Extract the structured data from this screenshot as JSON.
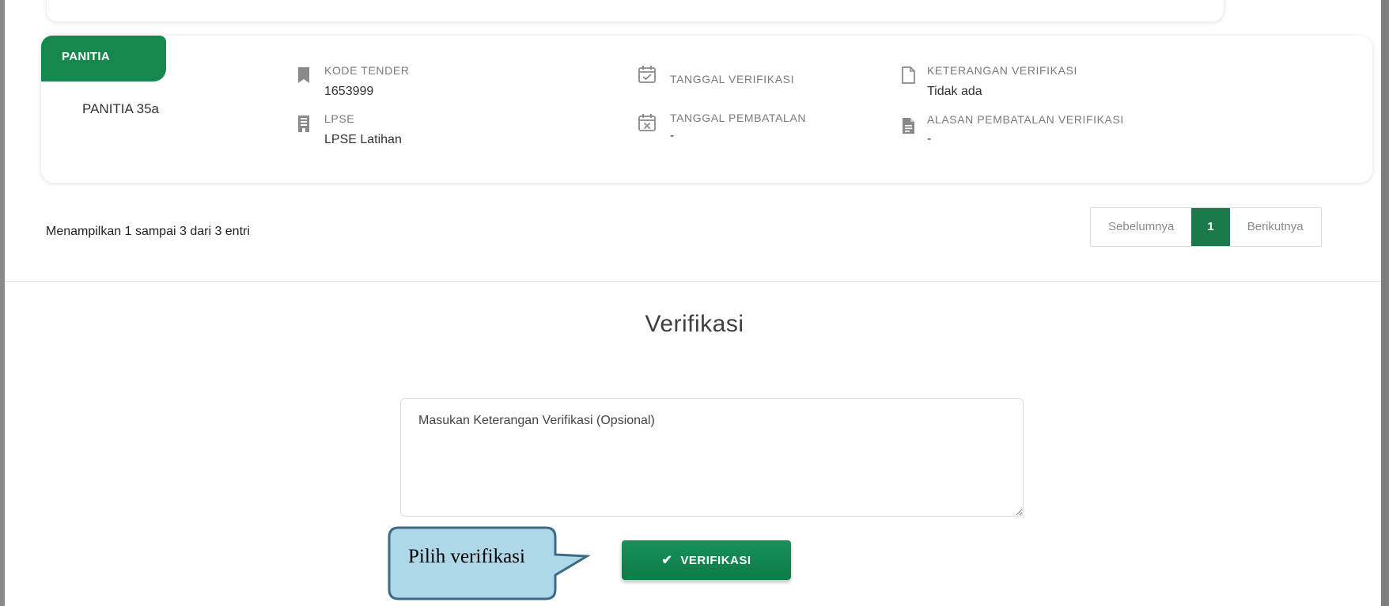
{
  "panel": {
    "tag": "PANITIA",
    "name": "PANITIA 35a",
    "fields": {
      "kode_tender": {
        "label": "KODE TENDER",
        "value": "1653999",
        "icon": "bookmark-icon"
      },
      "lpse": {
        "label": "LPSE",
        "value": "LPSE Latihan",
        "icon": "building-icon"
      },
      "tanggal_verifikasi": {
        "label": "TANGGAL VERIFIKASI",
        "value": "",
        "icon": "calendar-check-icon"
      },
      "tanggal_pembatalan": {
        "label": "TANGGAL PEMBATALAN",
        "value": "-",
        "icon": "calendar-x-icon"
      },
      "keterangan_verifikasi": {
        "label": "KETERANGAN VERIFIKASI",
        "value": "Tidak ada",
        "icon": "file-outline-icon"
      },
      "alasan_pembatalan": {
        "label": "ALASAN PEMBATALAN VERIFIKASI",
        "value": "-",
        "icon": "file-text-icon"
      }
    }
  },
  "pagination": {
    "summary": "Menampilkan 1 sampai 3 dari 3 entri",
    "prev": "Sebelumnya",
    "current": "1",
    "next": "Berikutnya"
  },
  "verifikasi": {
    "title": "Verifikasi",
    "placeholder": "Masukan Keterangan Verifikasi (Opsional)",
    "button_label": "VERIFIKASI",
    "button_icon": "check-icon"
  },
  "callout": {
    "text": "Pilih verifikasi"
  },
  "colors": {
    "accent": "#17884d",
    "page_active": "#1a7a4a",
    "callout_fill": "#aed8e8",
    "callout_border": "#3d6a84"
  }
}
